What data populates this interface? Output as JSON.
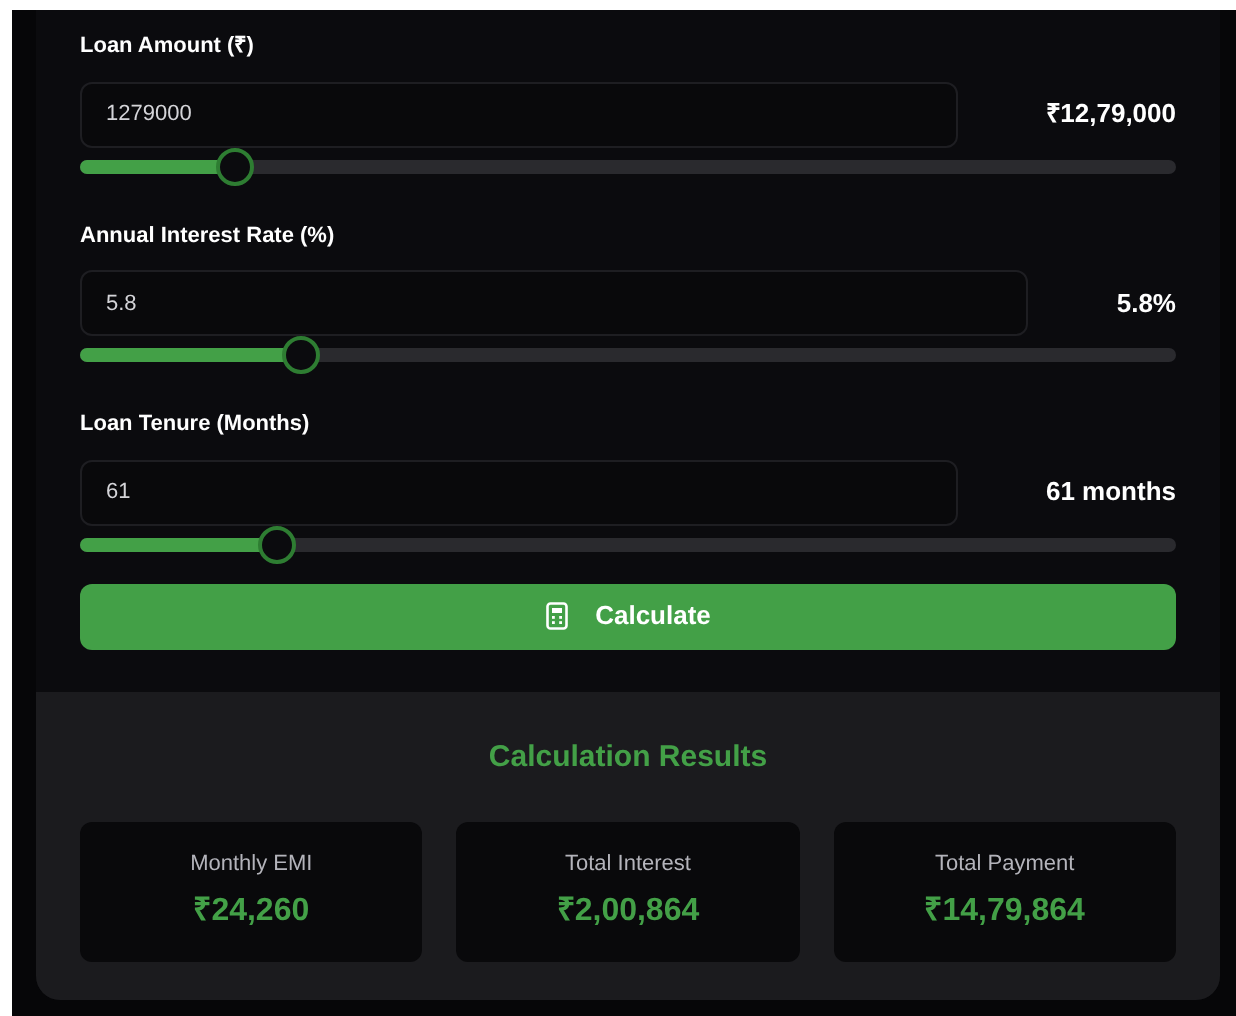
{
  "fields": [
    {
      "label": "Loan Amount (₹)",
      "value": "1279000",
      "display": "₹12,79,000",
      "level": 0.14
    },
    {
      "label": "Annual Interest Rate (%)",
      "value": "5.8",
      "display": "5.8%",
      "level": 0.2
    },
    {
      "label": "Loan Tenure (Months)",
      "value": "61",
      "display": "61 months",
      "level": 0.178
    }
  ],
  "calculate_button": {
    "label": "Calculate"
  },
  "results": {
    "title": "Calculation Results",
    "cards": [
      {
        "label": "Monthly EMI",
        "value": "₹24,260"
      },
      {
        "label": "Total Interest",
        "value": "₹2,00,864"
      },
      {
        "label": "Total Payment",
        "value": "₹14,79,864"
      }
    ]
  }
}
